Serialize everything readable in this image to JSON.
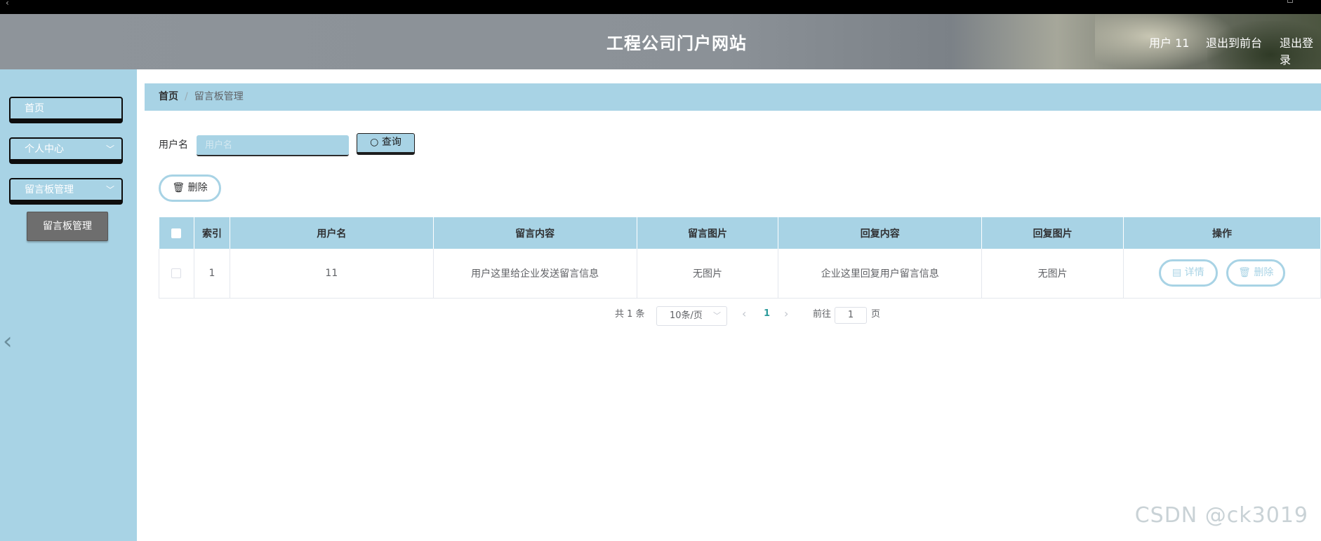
{
  "header": {
    "title": "工程公司门户网站",
    "user": "用户 11",
    "exit_front": "退出到前台",
    "logout": "退出登录"
  },
  "sidebar": {
    "items": [
      {
        "label": "首页"
      },
      {
        "label": "个人中心"
      },
      {
        "label": "留言板管理"
      }
    ],
    "sub_item": "留言板管理"
  },
  "breadcrumb": {
    "home": "首页",
    "separator": "/",
    "current": "留言板管理"
  },
  "search": {
    "label": "用户名",
    "placeholder": "用户名",
    "button": "查询"
  },
  "actions": {
    "delete": "删除"
  },
  "table": {
    "headers": [
      "索引",
      "用户名",
      "留言内容",
      "留言图片",
      "回复内容",
      "回复图片",
      "操作"
    ],
    "rows": [
      {
        "index": "1",
        "username": "11",
        "content": "用户这里给企业发送留言信息",
        "image": "无图片",
        "reply": "企业这里回复用户留言信息",
        "reply_image": "无图片",
        "detail": "详情",
        "delete": "删除"
      }
    ]
  },
  "pagination": {
    "total": "共 1 条",
    "page_size": "10条/页",
    "current_page": "1",
    "goto_label": "前往",
    "goto_value": "1",
    "goto_suffix": "页"
  },
  "watermark": "CSDN @ck3019",
  "colors": {
    "accent": "#a8d3e5",
    "pager_active": "#2c9b9b"
  }
}
